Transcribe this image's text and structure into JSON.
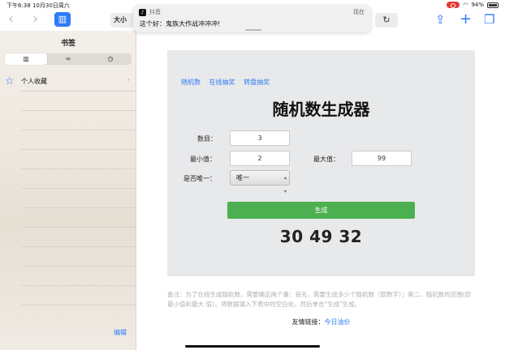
{
  "status_bar": {
    "time": "下午6:38",
    "date": "10月30日周六",
    "battery": "94%"
  },
  "toolbar": {
    "back_icon": "chevron-left-icon",
    "forward_icon": "chevron-right-icon",
    "bookmarks_icon": "book-icon",
    "reader_label": "大小",
    "reload_icon": "reload-icon",
    "share_icon": "share-icon",
    "new_tab_icon": "plus-icon",
    "tabs_icon": "tabs-icon"
  },
  "notification": {
    "app_name": "抖音",
    "time": "现在",
    "message": "这个好：鬼族大作战冲冲冲!"
  },
  "sidebar": {
    "title": "书签",
    "segments": [
      "book",
      "reading-list",
      "history"
    ],
    "favorites_label": "个人收藏",
    "edit_label": "编辑"
  },
  "page": {
    "links": [
      "随机数",
      "在线抽奖",
      "转盘抽奖"
    ],
    "title": "随机数生成器",
    "count_label": "数目：",
    "count_value": "3",
    "min_label": "最小值：",
    "min_value": "2",
    "max_label": "最大值：",
    "max_value": "99",
    "unique_label": "是否唯一：",
    "unique_value": "唯一",
    "generate_label": "生成",
    "result": "30 49 32",
    "note": "备注：为了在线生成随机数，需要确定两个量：首先，需要生成多少个随机数（即数字）；第二、随机数的范围(即最小值和最大 值）。将数据填入下表中的空白处，然后单击\"生成\"生成。",
    "friend_label": "友情链接：",
    "friend_link": "今日油价"
  },
  "colors": {
    "accent": "#2f7cf6",
    "button": "#4caf50",
    "panel": "#e8e9eb"
  }
}
